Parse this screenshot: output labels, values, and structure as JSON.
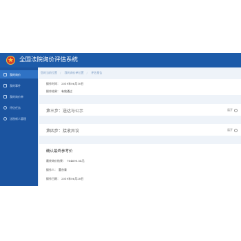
{
  "app": {
    "title": "全国法院询价评估系统"
  },
  "sidebar": {
    "items": [
      {
        "label": "我的询价"
      },
      {
        "label": "我的事件"
      },
      {
        "label": "我的询价单"
      },
      {
        "label": "评估任务"
      },
      {
        "label": "法院新人管理"
      }
    ]
  },
  "breadcrumb": [
    "您的当前位置",
    "我的询价单位置",
    "评估报告"
  ],
  "top_card": {
    "rows": [
      {
        "key": "操作时间：",
        "value": "2019年06月10日"
      },
      {
        "key": "操作结果：",
        "value": "有效通过"
      }
    ]
  },
  "steps": [
    {
      "title": "第三步：送达与公示",
      "expand_label": "展开"
    },
    {
      "title": "第四步：接收异议",
      "expand_label": "展开"
    }
  ],
  "reference": {
    "title": "确认最终参考价",
    "rows": [
      {
        "key": "最终询价结果：",
        "value": "764690.54元"
      },
      {
        "key": "操作人：",
        "value": "董京青"
      },
      {
        "key": "操作日期：",
        "value": "2019年06月28日"
      }
    ]
  }
}
